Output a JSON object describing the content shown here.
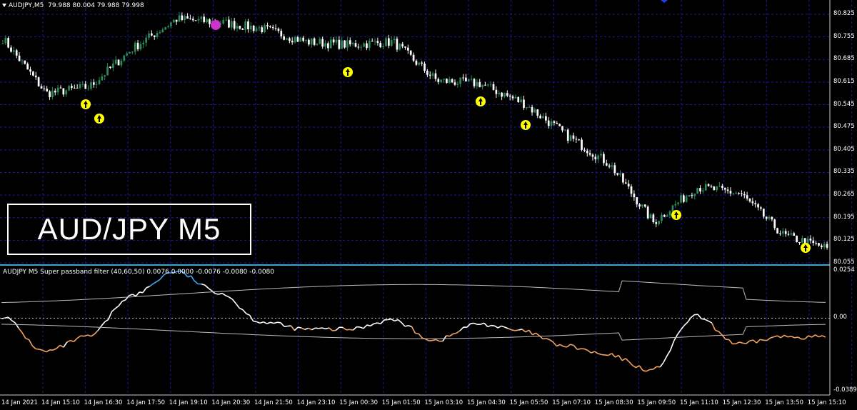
{
  "main_panel": {
    "symbol_label": "AUDJPY,M5",
    "ohlc_text": "79.988 80.004 79.988 79.998",
    "watermark": "AUD/JPY M5",
    "price_axis": [
      "80.825",
      "80.755",
      "80.685",
      "80.615",
      "80.545",
      "80.475",
      "80.405",
      "80.335",
      "80.265",
      "80.195",
      "80.125",
      "80.055"
    ],
    "arrow_count": 8,
    "colors": {
      "bull_candle": "#2e8b57",
      "bear_candle": "#ffffff",
      "grid": "#1a1a99",
      "arrow_up": "#ffff00",
      "marker": "#cc33cc"
    }
  },
  "indicator_panel": {
    "title": "AUDJPY M5 Super passband filter (40,60,50) 0.0076 0.0000 -0.0076 -0.0080 -0.0080",
    "axis_labels": [
      "0.0254",
      "0.00",
      "-0.0389"
    ],
    "colors": {
      "up": "#3fa9f5",
      "down": "#f4a460",
      "neutral": "#ffffff",
      "band": "#bbbbbb"
    }
  },
  "time_axis": [
    "14 Jan 2021",
    "14 Jan 15:10",
    "14 Jan 16:30",
    "14 Jan 17:50",
    "14 Jan 19:10",
    "14 Jan 20:30",
    "14 Jan 21:50",
    "14 Jan 23:10",
    "15 Jan 00:30",
    "15 Jan 01:50",
    "15 Jan 03:10",
    "15 Jan 04:30",
    "15 Jan 05:50",
    "15 Jan 07:10",
    "15 Jan 08:30",
    "15 Jan 09:50",
    "15 Jan 11:10",
    "15 Jan 12:30",
    "15 Jan 13:50",
    "15 Jan 15:10"
  ],
  "chart_data": {
    "type": "line",
    "title": "AUDJPY,M5",
    "series": [
      {
        "name": "AUDJPY,M5",
        "x": [
          "14 Jan 2021",
          "14 Jan 15:10",
          "14 Jan 16:30",
          "14 Jan 17:50",
          "14 Jan 19:10",
          "14 Jan 20:30",
          "14 Jan 21:50",
          "14 Jan 23:10",
          "15 Jan 00:30",
          "15 Jan 01:50",
          "15 Jan 03:10",
          "15 Jan 04:30",
          "15 Jan 05:50",
          "15 Jan 07:10",
          "15 Jan 08:30",
          "15 Jan 09:50",
          "15 Jan 11:10",
          "15 Jan 12:30",
          "15 Jan 13:50",
          "15 Jan 15:10"
        ],
        "values": [
          80.75,
          80.58,
          80.6,
          80.72,
          80.81,
          80.8,
          80.78,
          80.74,
          80.73,
          80.74,
          80.62,
          80.61,
          80.55,
          80.45,
          80.36,
          80.18,
          80.29,
          80.27,
          80.14,
          80.1
        ]
      },
      {
        "name": "Super passband filter",
        "x": [
          "14 Jan 2021",
          "14 Jan 15:10",
          "14 Jan 16:30",
          "14 Jan 17:50",
          "14 Jan 19:10",
          "14 Jan 20:30",
          "14 Jan 21:50",
          "14 Jan 23:10",
          "15 Jan 00:30",
          "15 Jan 01:50",
          "15 Jan 03:10",
          "15 Jan 04:30",
          "15 Jan 05:50",
          "15 Jan 07:10",
          "15 Jan 08:30",
          "15 Jan 09:50",
          "15 Jan 11:10",
          "15 Jan 12:30",
          "15 Jan 13:50",
          "15 Jan 15:10"
        ],
        "values": [
          0.001,
          -0.018,
          -0.01,
          0.012,
          0.025,
          0.014,
          -0.002,
          -0.006,
          -0.006,
          -0.001,
          -0.012,
          -0.003,
          -0.007,
          -0.015,
          -0.02,
          -0.028,
          0.001,
          -0.014,
          -0.01,
          -0.01
        ]
      }
    ],
    "ylim": [
      80.055,
      80.825
    ]
  }
}
